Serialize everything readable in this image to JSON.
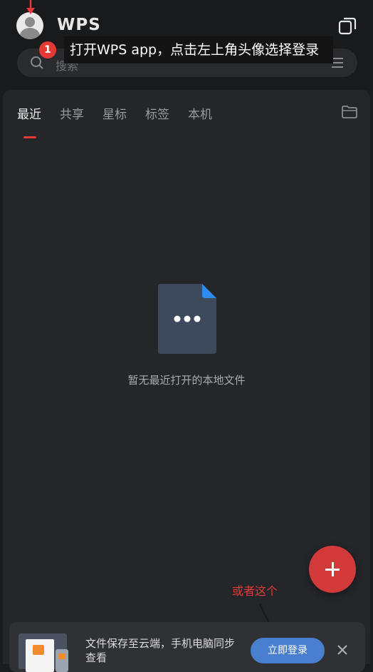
{
  "header": {
    "logo": "WPS",
    "notification_count": "1",
    "tooltip": "打开WPS app，点击左上角头像选择登录",
    "search_placeholder": "搜索"
  },
  "tabs": [
    {
      "label": "最近",
      "active": true
    },
    {
      "label": "共享",
      "active": false
    },
    {
      "label": "星标",
      "active": false
    },
    {
      "label": "标签",
      "active": false
    },
    {
      "label": "本机",
      "active": false
    }
  ],
  "empty_state": {
    "message": "暂无最近打开的本地文件"
  },
  "annotation": {
    "text": "或者这个",
    "color": "#e53935"
  },
  "banner": {
    "text": "文件保存至云端，手机电脑同步查看",
    "button_label": "立即登录"
  },
  "colors": {
    "accent": "#e53935",
    "fab": "#d23a3a",
    "login_button": "#4a7fcf",
    "background": "#1b1c1e"
  },
  "icons": [
    "avatar",
    "window-icon",
    "search-icon",
    "filter-icon",
    "folder-icon",
    "document-icon",
    "plus-icon",
    "close-icon"
  ]
}
